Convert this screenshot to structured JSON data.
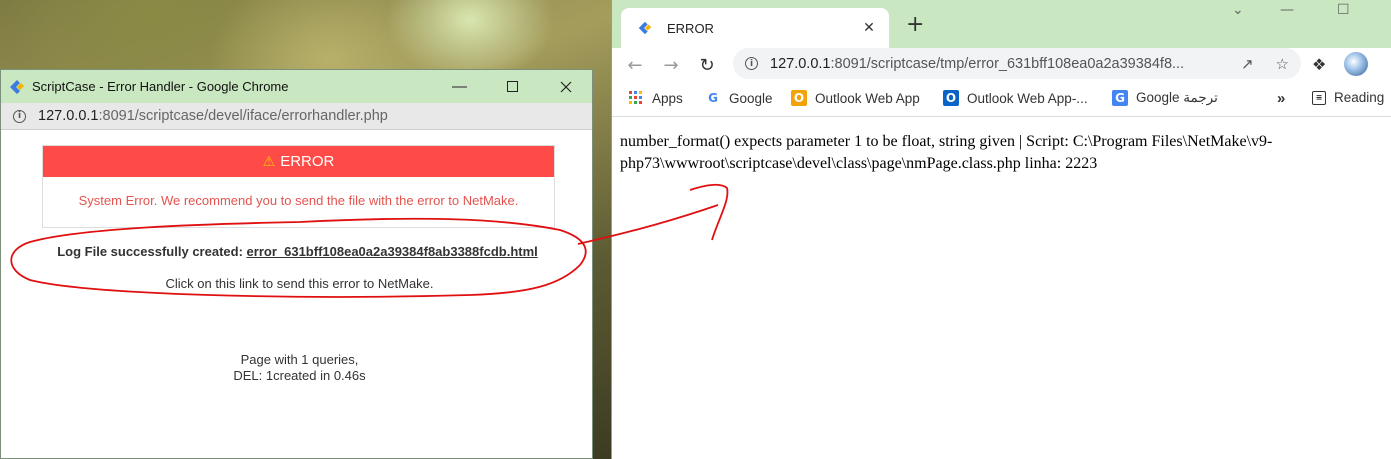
{
  "popup": {
    "title": "ScriptCase - Error Handler - Google Chrome",
    "url_host": "127.0.0.1",
    "url_path": ":8091/scriptcase/devel/iface/errorhandler.php",
    "error_header": "ERROR",
    "error_message": "System Error. We recommend you to send the file with the error to NetMake.",
    "log_label": "Log File successfully created:",
    "log_file": "error_631bff108ea0a2a39384f8ab3388fcdb.html",
    "send_text": "Click on this link to send this error to NetMake.",
    "footer_line1": "Page with 1 queries,",
    "footer_line2": "DEL: 1created in 0.46s"
  },
  "browser": {
    "tab_title": "ERROR",
    "url_host": "127.0.0.1",
    "url_path": ":8091/scriptcase/tmp/error_631bff108ea0a2a39384f8...",
    "bookmarks": [
      {
        "label": "Apps",
        "icon": "apps-grid-icon"
      },
      {
        "label": "Google",
        "icon": "google-icon"
      },
      {
        "label": "Outlook Web App",
        "icon": "outlook-icon"
      },
      {
        "label": "Outlook Web App-...",
        "icon": "outlook-icon"
      },
      {
        "label": "Google ترجمة",
        "icon": "google-translate-icon"
      }
    ],
    "more_bookmarks": "»",
    "reading_list": "Reading",
    "page_text": "number_format() expects parameter 1 to be float, string given | Script: C:\\Program Files\\NetMake\\v9-php73\\wwwroot\\scriptcase\\devel\\class\\page\\nmPage.class.php linha: 2223"
  },
  "colors": {
    "title_bar": "#c9e7c0",
    "error_header": "#ff4b48",
    "error_text": "#e4534f",
    "annotation": "#e01010"
  }
}
